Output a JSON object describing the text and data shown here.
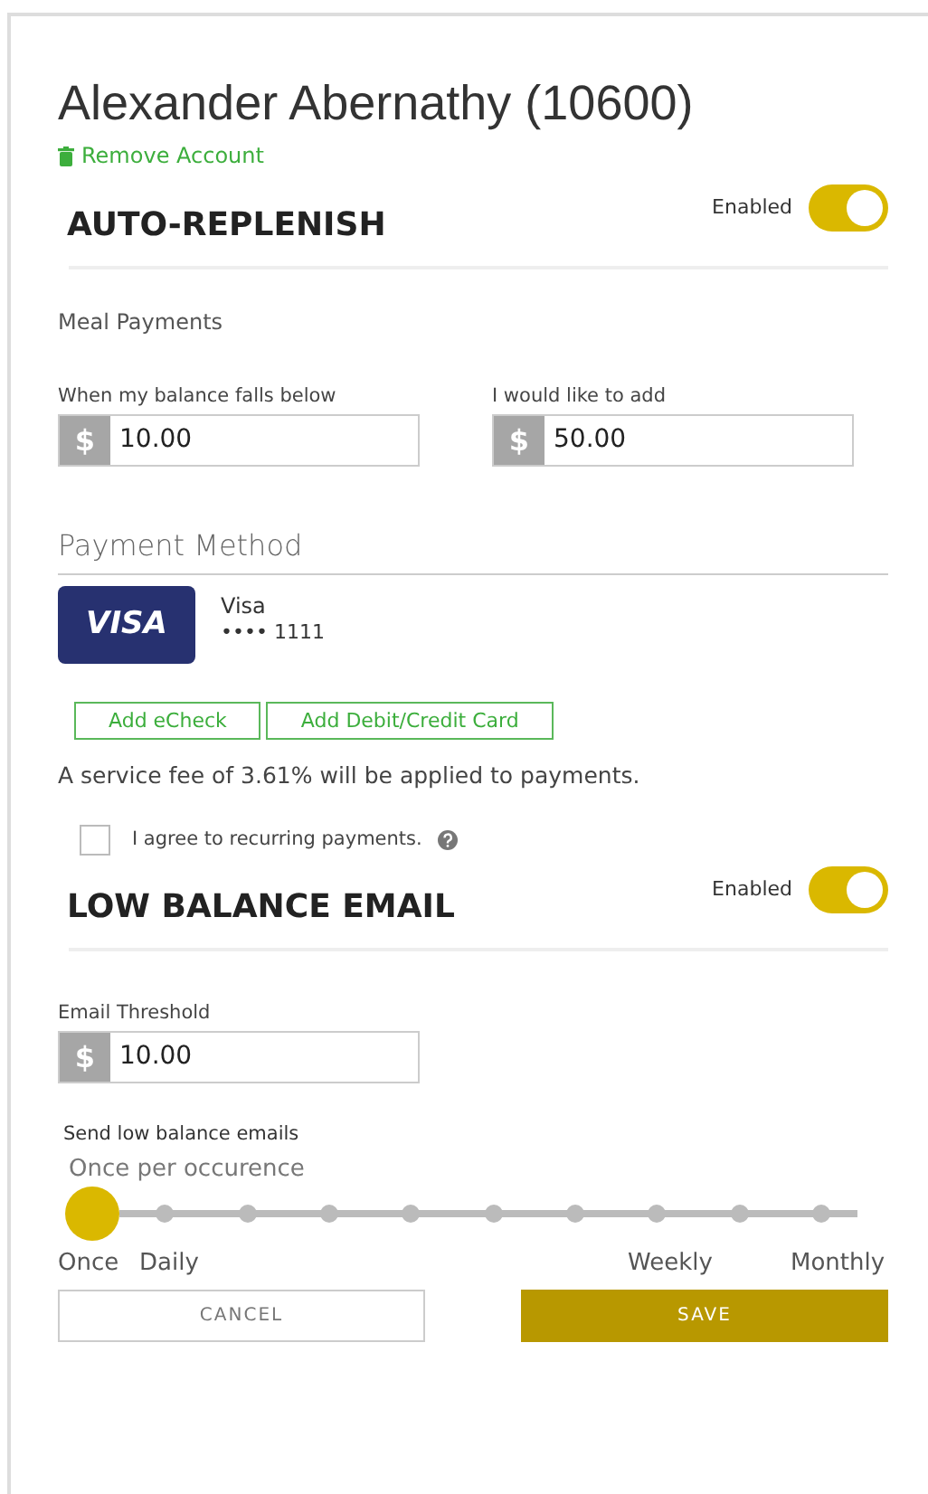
{
  "account": {
    "title": "Alexander Abernathy (10600)",
    "remove_link": "Remove Account"
  },
  "auto_replenish": {
    "heading": "AUTO-REPLENISH",
    "toggle_label": "Enabled",
    "on": true,
    "subheading": "Meal Payments",
    "fields": [
      {
        "label": "When my balance falls below",
        "prefix": "$",
        "value": "10.00"
      },
      {
        "label": "I would like to add",
        "prefix": "$",
        "value": "50.00"
      }
    ]
  },
  "payment_method": {
    "heading": "Payment Method",
    "card": {
      "logo": "VISA",
      "brand": "Visa",
      "number": "•••• 1111"
    },
    "buttons": [
      "Add eCheck",
      "Add Debit/Credit Card"
    ],
    "fee_note": "A service fee of 3.61% will be applied to payments.",
    "agree": {
      "label": "I agree to recurring payments.",
      "checked": false
    }
  },
  "low_balance_email": {
    "heading": "LOW BALANCE EMAIL",
    "toggle_label": "Enabled",
    "on": true,
    "threshold": {
      "label": "Email Threshold",
      "prefix": "$",
      "value": "10.00"
    },
    "frequency": {
      "label": "Send low balance emails",
      "current": "Once per occurence",
      "level": 0,
      "tick_labels": [
        "Once",
        "Daily",
        "Weekly",
        "Monthly"
      ]
    }
  },
  "actions": {
    "cancel": "CANCEL",
    "save": "SAVE"
  }
}
